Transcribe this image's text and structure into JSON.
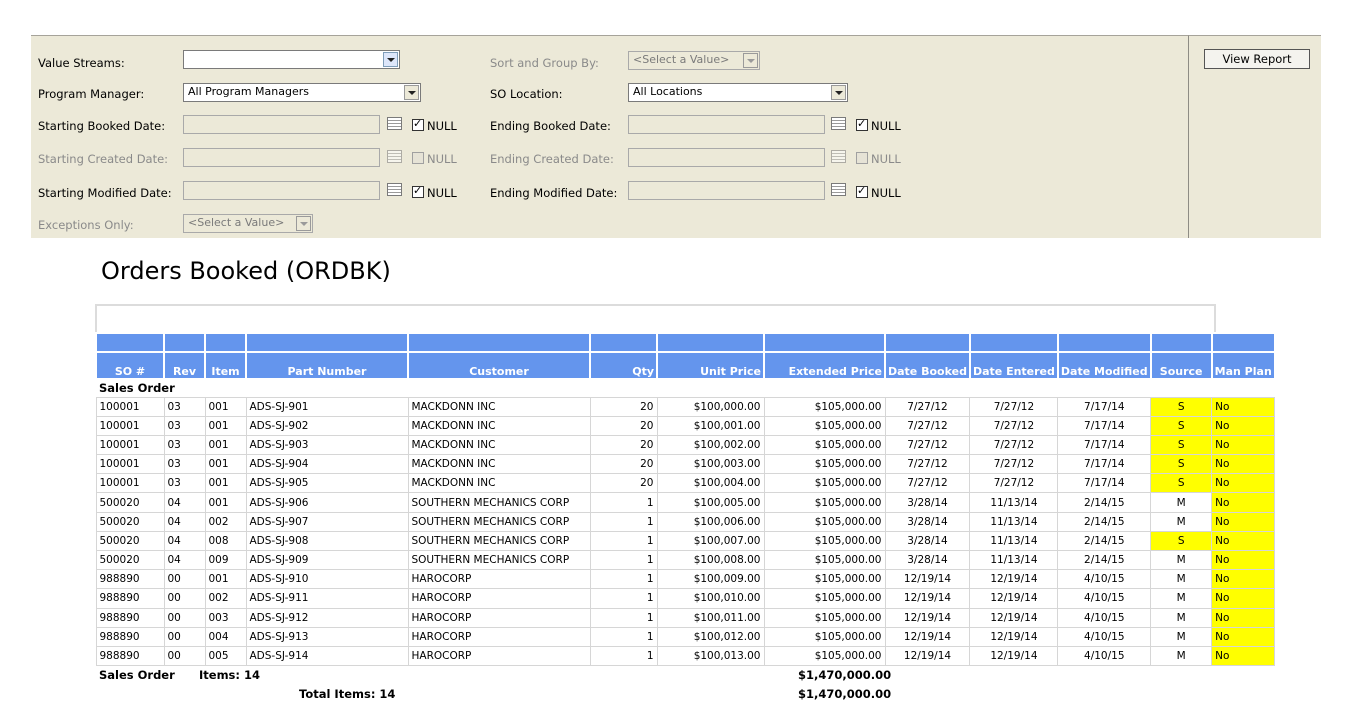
{
  "params": {
    "value_streams_label": "Value Streams:",
    "program_manager_label": "Program Manager:",
    "program_manager_value": "All Program Managers",
    "starting_booked_label": "Starting Booked Date:",
    "starting_created_label": "Starting Created Date:",
    "starting_modified_label": "Starting Modified Date:",
    "exceptions_label": "Exceptions Only:",
    "exceptions_value": "<Select a Value>",
    "sort_group_label": "Sort and Group By:",
    "sort_group_value": "<Select a Value>",
    "so_location_label": "SO Location:",
    "so_location_value": "All Locations",
    "ending_booked_label": "Ending Booked Date:",
    "ending_created_label": "Ending Created Date:",
    "ending_modified_label": "Ending Modified Date:",
    "null_label": "NULL",
    "view_report": "View Report"
  },
  "report": {
    "title": "Orders Booked (ORDBK)",
    "columns": [
      "SO #",
      "Rev",
      "Item",
      "Part Number",
      "Customer",
      "Qty",
      "Unit Price",
      "Extended Price",
      "Date Booked",
      "Date Entered",
      "Date Modified",
      "Source",
      "Man Plan"
    ],
    "group_label": "Sales Order",
    "rows": [
      [
        "100001",
        "03",
        "001",
        "ADS-SJ-901",
        "MACKDONN INC",
        "20",
        "$100,000.00",
        "$105,000.00",
        "7/27/12",
        "7/27/12",
        "7/17/14",
        "S",
        "No"
      ],
      [
        "100001",
        "03",
        "001",
        "ADS-SJ-902",
        "MACKDONN INC",
        "20",
        "$100,001.00",
        "$105,000.00",
        "7/27/12",
        "7/27/12",
        "7/17/14",
        "S",
        "No"
      ],
      [
        "100001",
        "03",
        "001",
        "ADS-SJ-903",
        "MACKDONN INC",
        "20",
        "$100,002.00",
        "$105,000.00",
        "7/27/12",
        "7/27/12",
        "7/17/14",
        "S",
        "No"
      ],
      [
        "100001",
        "03",
        "001",
        "ADS-SJ-904",
        "MACKDONN INC",
        "20",
        "$100,003.00",
        "$105,000.00",
        "7/27/12",
        "7/27/12",
        "7/17/14",
        "S",
        "No"
      ],
      [
        "100001",
        "03",
        "001",
        "ADS-SJ-905",
        "MACKDONN INC",
        "20",
        "$100,004.00",
        "$105,000.00",
        "7/27/12",
        "7/27/12",
        "7/17/14",
        "S",
        "No"
      ],
      [
        "500020",
        "04",
        "001",
        "ADS-SJ-906",
        "SOUTHERN MECHANICS CORP",
        "1",
        "$100,005.00",
        "$105,000.00",
        "3/28/14",
        "11/13/14",
        "2/14/15",
        "M",
        "No"
      ],
      [
        "500020",
        "04",
        "002",
        "ADS-SJ-907",
        "SOUTHERN MECHANICS CORP",
        "1",
        "$100,006.00",
        "$105,000.00",
        "3/28/14",
        "11/13/14",
        "2/14/15",
        "M",
        "No"
      ],
      [
        "500020",
        "04",
        "008",
        "ADS-SJ-908",
        "SOUTHERN MECHANICS CORP",
        "1",
        "$100,007.00",
        "$105,000.00",
        "3/28/14",
        "11/13/14",
        "2/14/15",
        "S",
        "No"
      ],
      [
        "500020",
        "04",
        "009",
        "ADS-SJ-909",
        "SOUTHERN MECHANICS CORP",
        "1",
        "$100,008.00",
        "$105,000.00",
        "3/28/14",
        "11/13/14",
        "2/14/15",
        "M",
        "No"
      ],
      [
        "988890",
        "00",
        "001",
        "ADS-SJ-910",
        "HAROCORP",
        "1",
        "$100,009.00",
        "$105,000.00",
        "12/19/14",
        "12/19/14",
        "4/10/15",
        "M",
        "No"
      ],
      [
        "988890",
        "00",
        "002",
        "ADS-SJ-911",
        "HAROCORP",
        "1",
        "$100,010.00",
        "$105,000.00",
        "12/19/14",
        "12/19/14",
        "4/10/15",
        "M",
        "No"
      ],
      [
        "988890",
        "00",
        "003",
        "ADS-SJ-912",
        "HAROCORP",
        "1",
        "$100,011.00",
        "$105,000.00",
        "12/19/14",
        "12/19/14",
        "4/10/15",
        "M",
        "No"
      ],
      [
        "988890",
        "00",
        "004",
        "ADS-SJ-913",
        "HAROCORP",
        "1",
        "$100,012.00",
        "$105,000.00",
        "12/19/14",
        "12/19/14",
        "4/10/15",
        "M",
        "No"
      ],
      [
        "988890",
        "00",
        "005",
        "ADS-SJ-914",
        "HAROCORP",
        "1",
        "$100,013.00",
        "$105,000.00",
        "12/19/14",
        "12/19/14",
        "4/10/15",
        "M",
        "No"
      ]
    ],
    "footer_group": "Sales Order",
    "footer_items": "Items: 14",
    "footer_group_total": "$1,470,000.00",
    "total_items": "Total Items: 14",
    "grand_total": "$1,470,000.00",
    "highlight_color": "#ffff00",
    "header_color": "#6495ed"
  }
}
